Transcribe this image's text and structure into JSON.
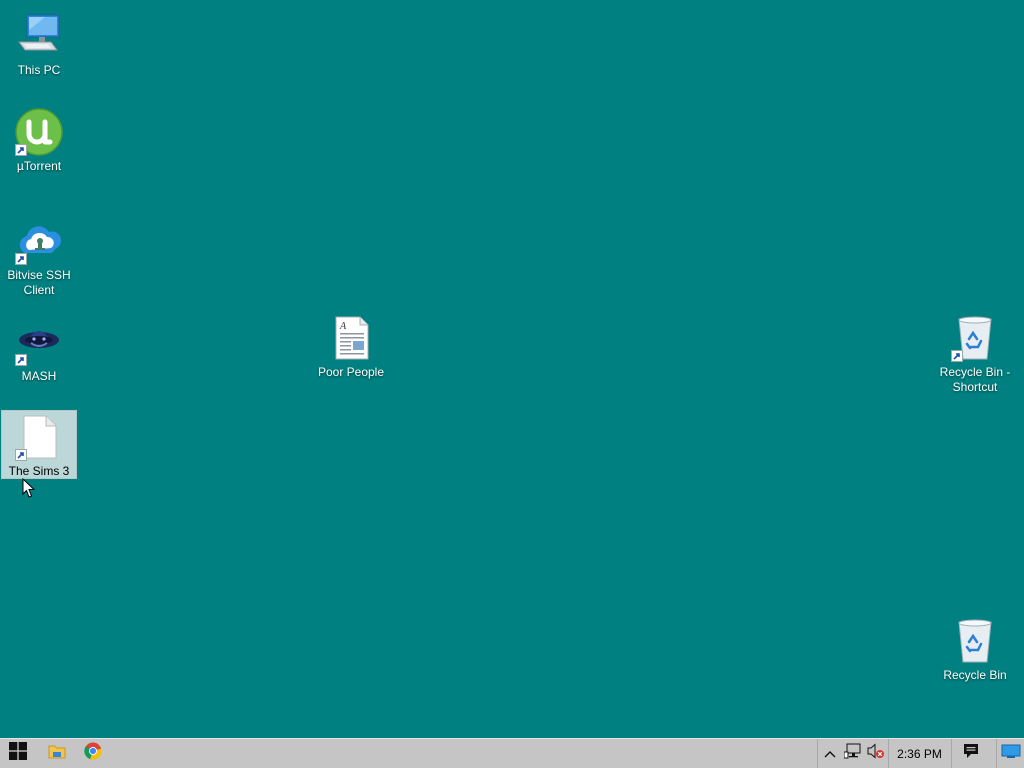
{
  "desktop": {
    "background_color": "#008080",
    "icons": [
      {
        "label": "This PC",
        "icon": "this-pc-icon",
        "shortcut": false
      },
      {
        "label": "µTorrent",
        "icon": "utorrent-icon",
        "shortcut": true
      },
      {
        "label": "Bitvise SSH Client",
        "icon": "bitvise-ssh-icon",
        "shortcut": true
      },
      {
        "label": "MASH",
        "icon": "mash-icon",
        "shortcut": true
      },
      {
        "label": "The Sims 3",
        "icon": "blank-file-icon",
        "shortcut": true,
        "selected": true
      },
      {
        "label": "Poor People",
        "icon": "document-icon",
        "shortcut": false
      },
      {
        "label": "Recycle Bin - Shortcut",
        "icon": "recycle-bin-icon",
        "shortcut": true
      },
      {
        "label": "Recycle Bin",
        "icon": "recycle-bin-icon",
        "shortcut": false
      }
    ]
  },
  "taskbar": {
    "start_icon": "windows-logo-icon",
    "pinned": [
      {
        "name": "File Explorer",
        "icon": "folder-icon"
      },
      {
        "name": "Google Chrome",
        "icon": "chrome-icon"
      }
    ],
    "tray": {
      "chevron_icon": "chevron-up-icon",
      "network_icon": "network-icon",
      "volume_icon": "volume-muted-icon",
      "clock": "2:36 PM",
      "notifications_icon": "action-center-icon",
      "show_desktop_icon": "show-desktop-icon"
    }
  }
}
